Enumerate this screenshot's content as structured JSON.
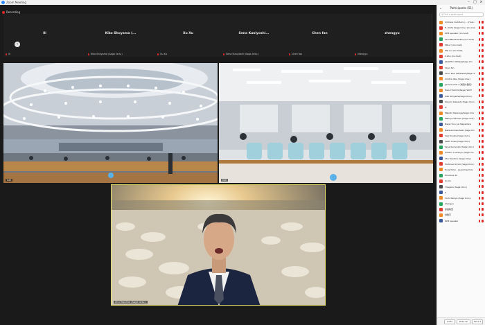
{
  "window": {
    "title": "Zoom Meeting",
    "minimize": "–",
    "maximize": "□",
    "close": "×"
  },
  "recording": {
    "label": "Recording"
  },
  "thumbnails": [
    {
      "name": "lli",
      "caption": "lli"
    },
    {
      "name": "Kiko Shoyama (...",
      "caption": "Kiko Shoyama (Saga Univ.)"
    },
    {
      "name": "Xu Xu",
      "caption": "Xu Xu"
    },
    {
      "name": "Sena Kuniyoshi...",
      "caption": "Sena Kuniyoshi (Saga Univ.)"
    },
    {
      "name": "Chen fan",
      "caption": "Chen fan"
    },
    {
      "name": "zhengyu",
      "caption": "zhengyu"
    }
  ],
  "videos": {
    "hall_left": {
      "caption": "hall"
    },
    "hall_right": {
      "caption": "hall"
    },
    "speaker": {
      "caption": "Shu Yasuhiro (Saga Univ.)"
    }
  },
  "sidebar": {
    "title": "Participants (51)",
    "search_placeholder": "Find a participant",
    "participants": [
      {
        "name": "Ichihara Yoshifumi (... (Host, me)",
        "color": "#f08a24"
      },
      {
        "name": "H. (Iihh) (Saga Univ.) (Co-host)",
        "color": "#e03c31"
      },
      {
        "name": "DP# speaker (Co-host)",
        "color": "#f08a24"
      },
      {
        "name": "StockBasilisaAkiss (Co-host)",
        "color": "#27a35b"
      },
      {
        "name": "Mihe Y (Co-host)",
        "color": "#e03c31"
      },
      {
        "name": "Mai Liu (Co-host)",
        "color": "#f08a24"
      },
      {
        "name": "S.Zhu (Co-host)",
        "color": "#e03c31"
      },
      {
        "name": "Jiteshfini Vattipoj(Saga Uni",
        "color": "#3b5998"
      },
      {
        "name": "Chen fan",
        "color": "#e03c31"
      },
      {
        "name": "Chen Rooi Matthews(Saga Univ.",
        "color": "#4a4a4a"
      },
      {
        "name": "dimitra Vaia (Saga Univ.)",
        "color": "#f08a24"
      },
      {
        "name": "gerard ameri（米国大使館）",
        "color": "#27a35b"
      },
      {
        "name": "Itazu Hoshimi(Saga) SAST",
        "color": "#f08a24"
      },
      {
        "name": "Kiko Shoyama(Saga Univ.)",
        "color": "#3b5998"
      },
      {
        "name": "Kozumi takaashi (Saga Univ.)",
        "color": "#4a4a4a"
      },
      {
        "name": "lli",
        "color": "#e03c31"
      },
      {
        "name": "Makoto Takenoga(Saga Univ",
        "color": "#f08a24"
      },
      {
        "name": "Makoya Kamitiri (Saga Univ)",
        "color": "#27a35b"
      },
      {
        "name": "Nakai Yoru Jun Bagashina",
        "color": "#3b5998"
      },
      {
        "name": "Nakaura Kasuhsiki (Saga Uni",
        "color": "#f08a24"
      },
      {
        "name": "Saki Kurata (Saga Univ.)",
        "color": "#e03c31"
      },
      {
        "name": "Sashi Inuse (Saga Univ.)",
        "color": "#4a4a4a"
      },
      {
        "name": "Sena Kuniyoshi (Saga Univ.)",
        "color": "#27a35b"
      },
      {
        "name": "Sokeno U Aoshyo (Saga Uni",
        "color": "#f08a24"
      },
      {
        "name": "Shu Yasuhiro (Saga Univ.)",
        "color": "#3b5998"
      },
      {
        "name": "Toshinao Kondo (Saga Univ.)",
        "color": "#e03c31"
      },
      {
        "name": "Tung Yuhei - spending Univ.",
        "color": "#f08a24"
      },
      {
        "name": "Windows 10",
        "color": "#27a35b"
      },
      {
        "name": "Xu Xu",
        "color": "#e03c31"
      },
      {
        "name": "Y.Sagara (Saga Univ.)",
        "color": "#4a4a4a"
      },
      {
        "name": "U",
        "color": "#3b5998"
      },
      {
        "name": "Yoshi Sekiya (Saga Univ.)",
        "color": "#f08a24"
      },
      {
        "name": "zhengyu",
        "color": "#27a35b"
      },
      {
        "name": "廖昌教室",
        "color": "#e03c31"
      },
      {
        "name": "刘轶宇",
        "color": "#f08a24"
      },
      {
        "name": "DP# speaker",
        "color": "#3b5998"
      }
    ],
    "invite_label": "Invite",
    "mute_all_label": "Mute All",
    "more_label": "More ▾"
  }
}
